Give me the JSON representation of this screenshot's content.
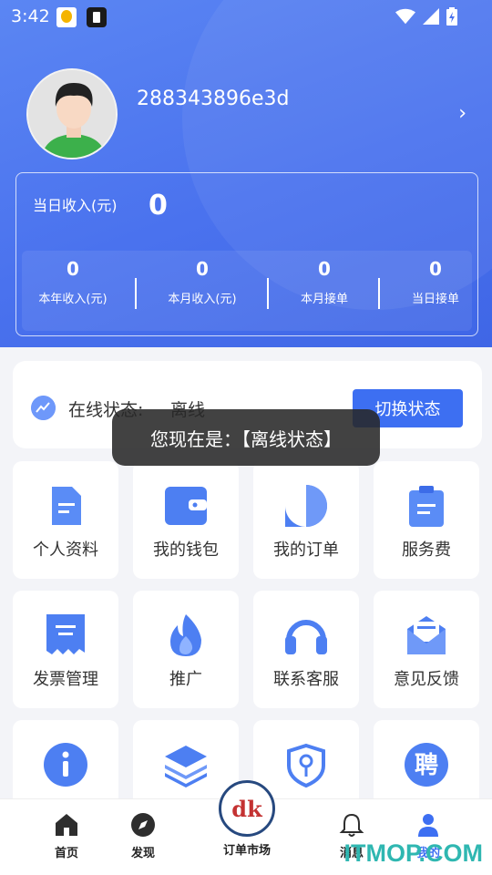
{
  "status_bar": {
    "time": "3:42"
  },
  "profile": {
    "username": "288343896e3d",
    "chevron": "›"
  },
  "income": {
    "today_label": "当日收入(元)",
    "today_value": "0",
    "stats": [
      {
        "value": "0",
        "label": "本年收入(元)"
      },
      {
        "value": "0",
        "label": "本月收入(元)"
      },
      {
        "value": "0",
        "label": "本月接单"
      },
      {
        "value": "0",
        "label": "当日接单"
      }
    ]
  },
  "online_status": {
    "label": "在线状态:",
    "value": "离线",
    "button": "切换状态"
  },
  "toast": "您现在是：【离线状态】",
  "tiles": [
    {
      "label": "个人资料",
      "icon": "document-icon"
    },
    {
      "label": "我的钱包",
      "icon": "wallet-icon"
    },
    {
      "label": "我的订单",
      "icon": "order-bubble-icon"
    },
    {
      "label": "服务费",
      "icon": "clipboard-icon"
    },
    {
      "label": "发票管理",
      "icon": "invoice-icon"
    },
    {
      "label": "推广",
      "icon": "flame-icon"
    },
    {
      "label": "联系客服",
      "icon": "headset-icon"
    },
    {
      "label": "意见反馈",
      "icon": "envelope-icon"
    },
    {
      "label": "",
      "icon": "info-icon"
    },
    {
      "label": "",
      "icon": "layers-icon"
    },
    {
      "label": "",
      "icon": "shield-key-icon"
    },
    {
      "label": "聘",
      "icon": "recruit-icon"
    }
  ],
  "nav": {
    "home": "首页",
    "discover": "发现",
    "market": "订单市场",
    "messages": "消息",
    "mine": "我的"
  },
  "watermark": "ITMOP.COM",
  "colors": {
    "primary": "#3d6ff2",
    "header": "#4a72ee"
  }
}
